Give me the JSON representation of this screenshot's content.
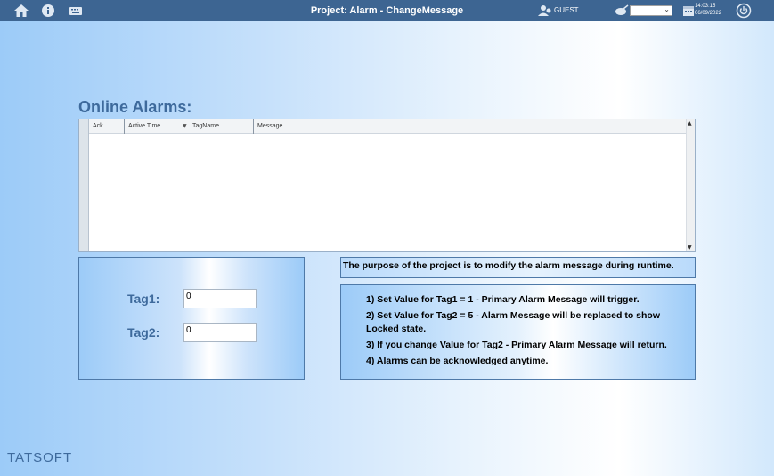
{
  "app": {
    "title": "Project: Alarm - ChangeMessage",
    "user": "GUEST",
    "clock_time": "14:03:15",
    "clock_date": "06/09/2022",
    "accent_color": "#3d6592"
  },
  "toolbar": {
    "icons": [
      "home-icon",
      "info-icon",
      "keyboard-icon",
      "user-icon",
      "theme-icon",
      "calendar-icon",
      "power-icon"
    ],
    "select_value": ""
  },
  "alarms": {
    "heading": "Online Alarms:",
    "columns": [
      "Ack",
      "Active Time",
      "TagName",
      "Message"
    ],
    "rows": []
  },
  "tags": {
    "tag1_label": "Tag1:",
    "tag1_value": "0",
    "tag2_label": "Tag2:",
    "tag2_value": "0"
  },
  "info": {
    "purpose": "The purpose of the project is to modify the alarm message during runtime.",
    "steps": [
      "1) Set Value for Tag1 = 1 - Primary Alarm Message will trigger.",
      "2) Set Value for Tag2 = 5 - Alarm Message will be replaced to show Locked state.",
      "3) If you change Value for Tag2 - Primary Alarm Message will return.",
      "4) Alarms can be acknowledged anytime."
    ]
  },
  "footer": {
    "logo": "TATSOFT"
  }
}
